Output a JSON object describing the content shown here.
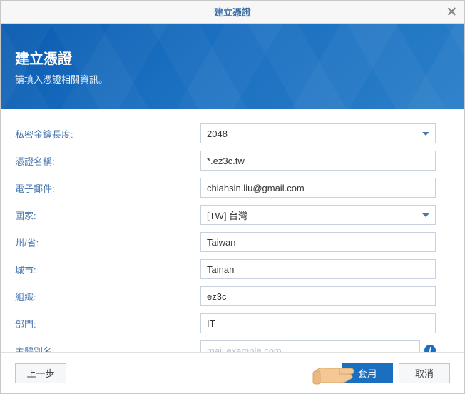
{
  "titlebar": {
    "title": "建立憑證"
  },
  "banner": {
    "heading": "建立憑證",
    "subtitle": "請填入憑證相關資訊。"
  },
  "form": {
    "key_length": {
      "label": "私密金鑰長度:",
      "value": "2048"
    },
    "cert_name": {
      "label": "憑證名稱:",
      "value": "*.ez3c.tw"
    },
    "email": {
      "label": "電子郵件:",
      "value": "chiahsin.liu@gmail.com"
    },
    "country": {
      "label": "國家:",
      "value": "[TW] 台灣"
    },
    "state": {
      "label": "州/省:",
      "value": "Taiwan"
    },
    "city": {
      "label": "城市:",
      "value": "Tainan"
    },
    "org": {
      "label": "組織:",
      "value": "ez3c"
    },
    "dept": {
      "label": "部門:",
      "value": "IT"
    },
    "san": {
      "label": "主體別名:",
      "value": "",
      "placeholder": "mail.example.com"
    }
  },
  "footer": {
    "back": "上一步",
    "apply": "套用",
    "cancel": "取消"
  }
}
